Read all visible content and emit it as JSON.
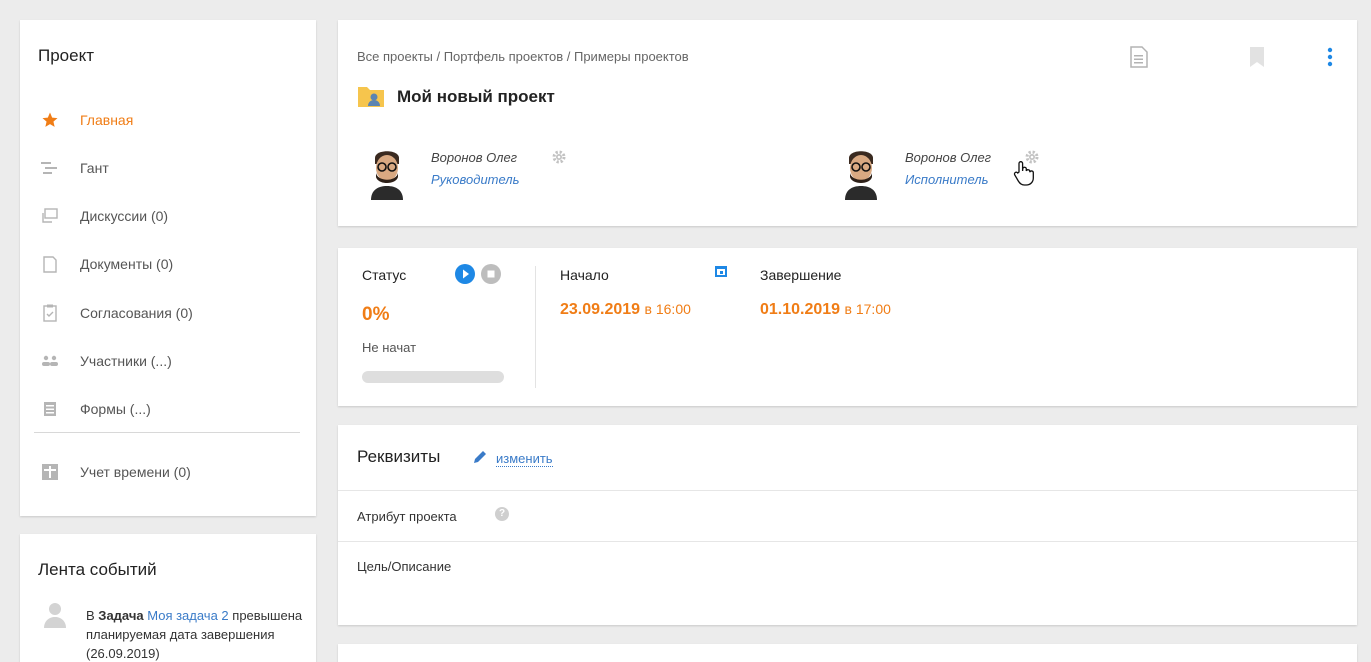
{
  "sidebar": {
    "title": "Проект",
    "items": [
      {
        "label": "Главная",
        "icon": "star-icon"
      },
      {
        "label": "Гант",
        "icon": "gantt-icon"
      },
      {
        "label": "Дискуссии (0)",
        "icon": "discussions-icon"
      },
      {
        "label": "Документы (0)",
        "icon": "document-icon"
      },
      {
        "label": "Согласования (0)",
        "icon": "approval-icon"
      },
      {
        "label": "Участники (...)",
        "icon": "participants-icon"
      },
      {
        "label": "Формы (...)",
        "icon": "forms-icon"
      },
      {
        "label": "Учет времени (0)",
        "icon": "time-tracking-icon"
      }
    ]
  },
  "events": {
    "title": "Лента событий",
    "item": {
      "prefix": "В",
      "bold": "Задача",
      "link": "Моя задача 2",
      "text": "превышена планируемая дата завершения (26.09.2019)"
    }
  },
  "header": {
    "breadcrumb": "Все проекты / Портфель проектов / Примеры проектов",
    "title": "Мой новый проект",
    "people": [
      {
        "name": "Воронов Олег",
        "role": "Руководитель"
      },
      {
        "name": "Воронов Олег",
        "role": "Исполнитель"
      }
    ]
  },
  "status": {
    "status_label": "Статус",
    "percent": "0%",
    "progress": 0,
    "state": "Не начат",
    "start_label": "Начало",
    "start_date": "23.09.2019",
    "start_time": "в 16:00",
    "end_label": "Завершение",
    "end_date": "01.10.2019",
    "end_time": "в 17:00"
  },
  "requisites": {
    "title": "Реквизиты",
    "edit_label": "изменить",
    "fields": [
      "Атрибут проекта",
      "Цель/Описание"
    ]
  },
  "colors": {
    "accent": "#f07d16",
    "link": "#3a7bc8",
    "play": "#1e88e5"
  }
}
